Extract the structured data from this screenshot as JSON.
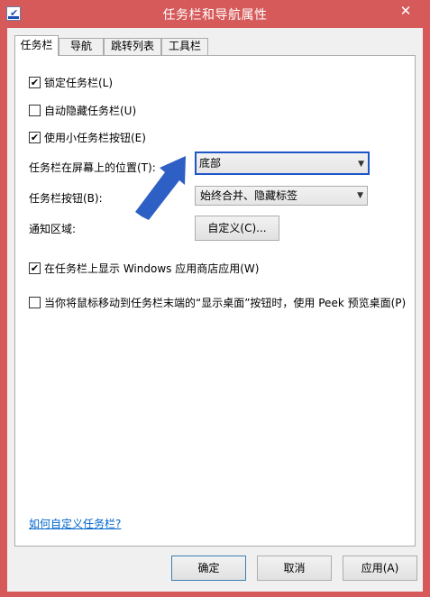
{
  "window": {
    "title": "任务栏和导航属性",
    "close_glyph": "✕",
    "frame_color": "#d65a5a"
  },
  "tabs": [
    {
      "label": "任务栏"
    },
    {
      "label": "导航"
    },
    {
      "label": "跳转列表"
    },
    {
      "label": "工具栏"
    }
  ],
  "options": {
    "lock_taskbar": {
      "label": "锁定任务栏(L)",
      "checked": true
    },
    "auto_hide": {
      "label": "自动隐藏任务栏(U)",
      "checked": false
    },
    "small_buttons": {
      "label": "使用小任务栏按钮(E)",
      "checked": true
    },
    "show_store_apps": {
      "label": "在任务栏上显示 Windows 应用商店应用(W)",
      "checked": true
    },
    "peek": {
      "label": "当你将鼠标移动到任务栏末端的“显示桌面”按钮时，使用 Peek 预览桌面(P)",
      "checked": false
    }
  },
  "fields": {
    "location_label": "任务栏在屏幕上的位置(T):",
    "location_value": "底部",
    "buttons_label": "任务栏按钮(B):",
    "buttons_value": "始终合并、隐藏标签",
    "notify_label": "通知区域:",
    "customize_button": "自定义(C)..."
  },
  "link": {
    "text": "如何自定义任务栏?"
  },
  "footer": {
    "ok": "确定",
    "cancel": "取消",
    "apply": "应用(A)"
  },
  "check_glyph": "✔",
  "dropdown_glyph": "▼",
  "annotation_color": "#2e5fc4"
}
